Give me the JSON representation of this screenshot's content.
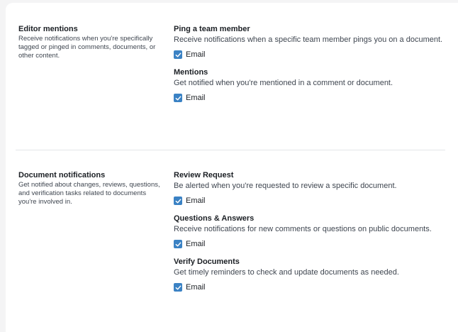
{
  "sections": [
    {
      "title": "Editor mentions",
      "description": "Receive notifications when you're specifically tagged or pinged in comments, documents, or other content.",
      "items": [
        {
          "title": "Ping a team member",
          "description": "Receive notifications when a specific team member pings you on a document.",
          "checkbox_label": "Email",
          "checked": true
        },
        {
          "title": "Mentions",
          "description": "Get notified when you're mentioned in a comment or document.",
          "checkbox_label": "Email",
          "checked": true
        }
      ]
    },
    {
      "title": "Document notifications",
      "description": "Get notified about changes, reviews, questions, and verification tasks related to documents you're involved in.",
      "items": [
        {
          "title": "Review Request",
          "description": "Be alerted when you're requested to review a specific document.",
          "checkbox_label": "Email",
          "checked": true
        },
        {
          "title": "Questions & Answers",
          "description": "Receive notifications for new comments or questions on public documents.",
          "checkbox_label": "Email",
          "checked": true
        },
        {
          "title": "Verify Documents",
          "description": "Get timely reminders to check and update documents as needed.",
          "checkbox_label": "Email",
          "checked": true
        }
      ]
    }
  ],
  "colors": {
    "checkbox": "#3b82c4",
    "divider": "#e3e5e8"
  }
}
